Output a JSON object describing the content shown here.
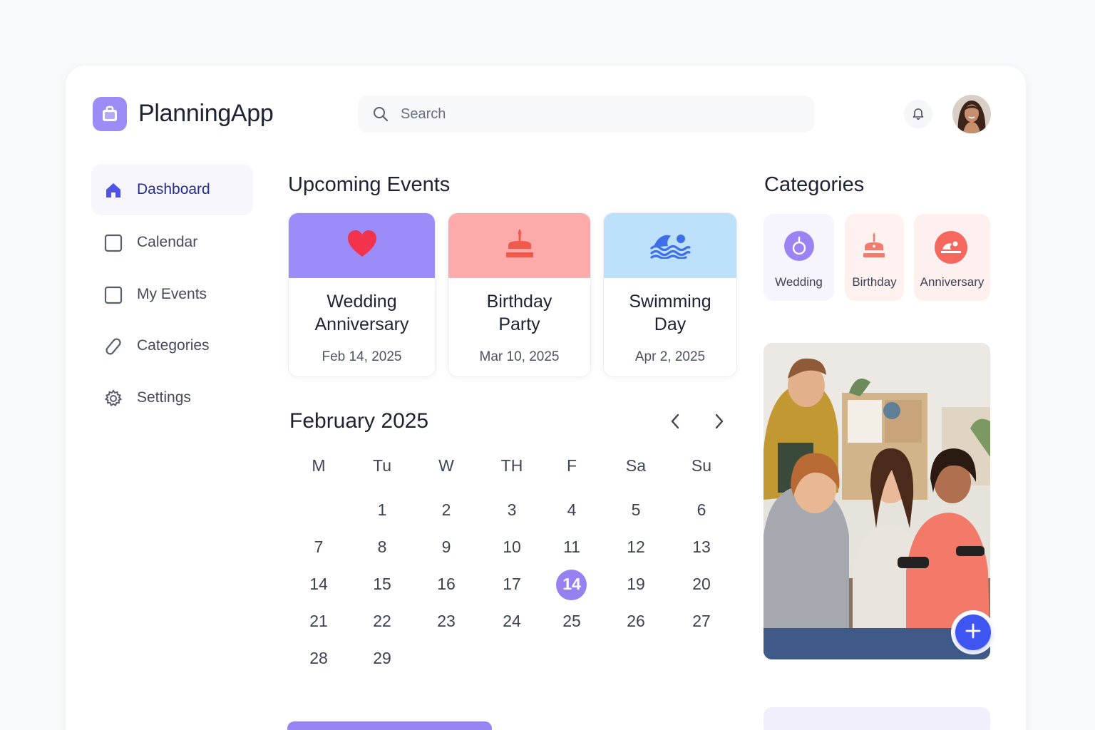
{
  "app": {
    "name": "PlanningApp"
  },
  "search": {
    "placeholder": "Search"
  },
  "sidebar": {
    "items": [
      {
        "label": "Dashboard",
        "icon": "home-icon",
        "active": true
      },
      {
        "label": "Calendar",
        "icon": "square-icon"
      },
      {
        "label": "My Events",
        "icon": "square-icon"
      },
      {
        "label": "Categories",
        "icon": "tag-icon"
      },
      {
        "label": "Settings",
        "icon": "gear-icon"
      }
    ]
  },
  "upcoming": {
    "title": "Upcoming Events",
    "events": [
      {
        "title_line1": "Wedding",
        "title_line2": "Anniversary",
        "date": "Feb 14, 2025",
        "icon": "heart-icon",
        "color": "#9b8cf9"
      },
      {
        "title_line1": "Birthday",
        "title_line2": "Party",
        "date": "Mar 10, 2025",
        "icon": "cake-icon",
        "color": "#fdaaaa"
      },
      {
        "title_line1": "Swimming",
        "title_line2": "Day",
        "date": "Apr 2, 2025",
        "icon": "swimmer-icon",
        "color": "#bde0fb"
      }
    ]
  },
  "calendar": {
    "month": "February 2025",
    "weekdays": [
      "M",
      "Tu",
      "W",
      "TH",
      "F",
      "Sa",
      "Su"
    ],
    "weeks": [
      [
        "",
        "1",
        "2",
        "3",
        "4",
        "5",
        "6"
      ],
      [
        "7",
        "8",
        "9",
        "10",
        "11",
        "12",
        "13"
      ],
      [
        "14",
        "15",
        "16",
        "17",
        "14",
        "19",
        "20"
      ],
      [
        "21",
        "22",
        "23",
        "24",
        "25",
        "26",
        "27"
      ],
      [
        "28",
        "29",
        "",
        "",
        "",
        "",
        ""
      ]
    ],
    "selected_day": "14",
    "accent": "#9781f1"
  },
  "categories": {
    "title": "Categories",
    "items": [
      {
        "label": "Wedding",
        "icon": "ring-icon",
        "bg": "#f6f5fd",
        "accent": "#9b83f3"
      },
      {
        "label": "Birthday",
        "icon": "cake-icon",
        "bg": "#fff1ef",
        "accent": "#f27a6e"
      },
      {
        "label": "Anniversary",
        "icon": "swimmer-icon",
        "bg": "#fff0f0",
        "accent": "#f4685e"
      }
    ]
  },
  "fab": {
    "icon": "plus-icon",
    "color": "#3f55f2"
  }
}
